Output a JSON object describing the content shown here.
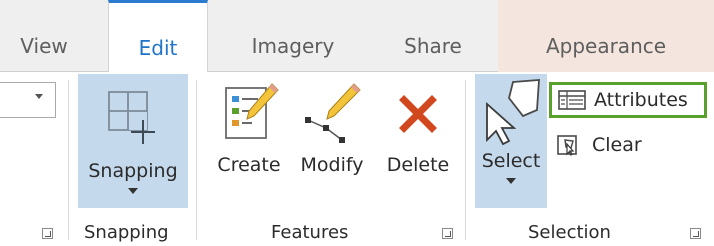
{
  "tabs": {
    "view": "View",
    "edit": "Edit",
    "imagery": "Imagery",
    "share": "Share",
    "appearance": "Appearance"
  },
  "active_tab": "Edit",
  "snapping_group": {
    "snapping_button": "Snapping",
    "label": "Snapping"
  },
  "features_group": {
    "create": "Create",
    "modify": "Modify",
    "delete": "Delete",
    "label": "Features"
  },
  "selection_group": {
    "select": "Select",
    "attributes": "Attributes",
    "clear": "Clear",
    "label": "Selection"
  },
  "colors": {
    "active_tab_text": "#1f74c9",
    "button_highlight": "#c5d9ec",
    "attributes_outline": "#5aa02c",
    "delete_x": "#d2481e",
    "appearance_tab_bg": "#f4e6de"
  },
  "icons": {
    "snapping": "grid-plus-icon",
    "create": "form-pencil-icon",
    "modify": "vertices-pencil-icon",
    "delete": "red-x-icon",
    "select": "cursor-polygon-icon",
    "attributes": "table-icon",
    "clear": "clear-selection-icon"
  }
}
